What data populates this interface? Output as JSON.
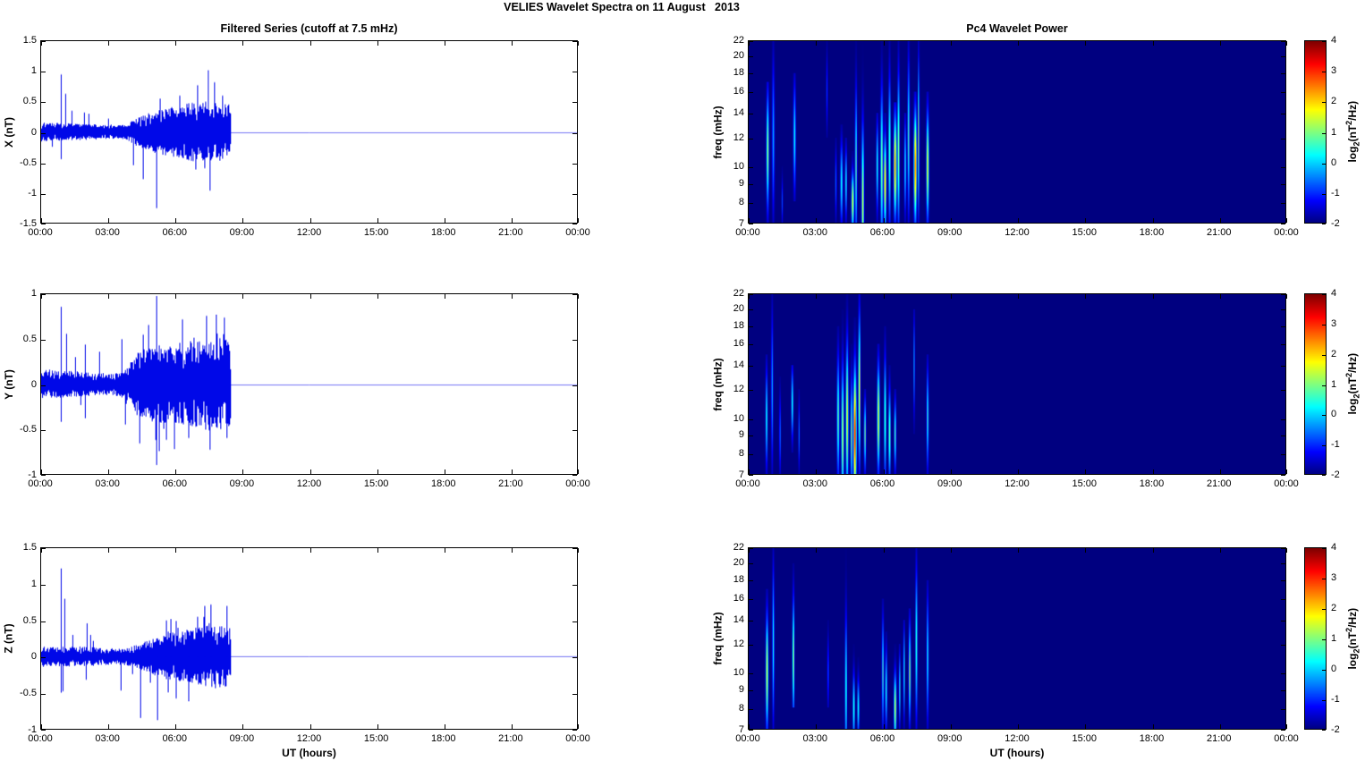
{
  "figure": {
    "title": "VELIES Wavelet Spectra on 11 August   2013"
  },
  "colorbar": {
    "ticks": [
      4,
      3,
      2,
      1,
      0,
      -1,
      -2
    ],
    "tick_labels": [
      "4",
      "3",
      "2",
      "1",
      "0",
      "-1",
      "-2"
    ],
    "vmin": -2,
    "vmax": 4,
    "label_parts": {
      "p1": "log",
      "sub": "2",
      "p2": "(nT",
      "sup": "2",
      "p3": "/Hz)"
    },
    "colormap": "jet",
    "background_hex": "#000080"
  },
  "chart_data": [
    {
      "type": "line",
      "component": "X",
      "title": "Filtered Series (cutoff at 7.5 mHz)",
      "ylabel": "X (nT)",
      "line_color": "#0008e8",
      "flat_line_color": "rgba(70,70,240,0.75)",
      "ylim": [
        -1.5,
        1.5
      ],
      "yticks": [
        -1.5,
        -1,
        -0.5,
        0,
        0.5,
        1,
        1.5
      ],
      "ytick_labels": [
        "-1.5",
        "-1",
        "-0.5",
        "0",
        "0.5",
        "1",
        "1.5"
      ],
      "xlim_hours": [
        0,
        24
      ],
      "xticks_hours": [
        0,
        3,
        6,
        9,
        12,
        15,
        18,
        21,
        24
      ],
      "xtick_labels": [
        "00:00",
        "03:00",
        "06:00",
        "09:00",
        "12:00",
        "15:00",
        "18:00",
        "21:00",
        "00:00"
      ],
      "signal": {
        "seed": 7,
        "end_hours": 8.5,
        "envelope": [
          [
            0,
            0.14
          ],
          [
            0.5,
            0.13
          ],
          [
            1,
            0.13
          ],
          [
            1.5,
            0.12
          ],
          [
            2,
            0.12
          ],
          [
            2.5,
            0.11
          ],
          [
            3,
            0.1
          ],
          [
            3.5,
            0.1
          ],
          [
            3.8,
            0.11
          ],
          [
            4.2,
            0.2
          ],
          [
            4.6,
            0.25
          ],
          [
            5,
            0.3
          ],
          [
            5.5,
            0.34
          ],
          [
            6,
            0.38
          ],
          [
            6.5,
            0.42
          ],
          [
            7,
            0.44
          ],
          [
            7.5,
            0.46
          ],
          [
            8,
            0.44
          ],
          [
            8.45,
            0.4
          ],
          [
            8.5,
            0.0
          ]
        ],
        "spikes": [
          [
            0.87,
            0.95
          ],
          [
            0.87,
            -0.45
          ],
          [
            1.07,
            0.63
          ],
          [
            1.35,
            0.35
          ],
          [
            1.9,
            0.32
          ],
          [
            2.1,
            0.3
          ],
          [
            3.0,
            0.22
          ],
          [
            4.1,
            -0.55
          ],
          [
            4.55,
            -0.78
          ],
          [
            5.15,
            -1.26
          ],
          [
            5.3,
            0.55
          ],
          [
            6.2,
            0.6
          ],
          [
            6.9,
            -0.62
          ],
          [
            7.3,
            -0.6
          ],
          [
            7.45,
            1.02
          ],
          [
            7.55,
            -0.97
          ],
          [
            7.75,
            0.82
          ],
          [
            8.1,
            0.6
          ]
        ]
      }
    },
    {
      "type": "heatmap",
      "component": "X",
      "title": "Pc4 Wavelet Power",
      "ylabel": "freq (mHz)",
      "ylim_mhz": [
        7,
        22
      ],
      "yscale": "log",
      "yticks": [
        7,
        8,
        9,
        10,
        12,
        14,
        16,
        18,
        20,
        22
      ],
      "xlim_hours": [
        0,
        24
      ],
      "xticks_hours": [
        0,
        3,
        6,
        9,
        12,
        15,
        18,
        21,
        24
      ],
      "xtick_labels": [
        "00:00",
        "03:00",
        "06:00",
        "09:00",
        "12:00",
        "15:00",
        "18:00",
        "21:00",
        "00:00"
      ],
      "clim": [
        -2,
        4
      ],
      "streak_fields": [
        "t_hours",
        "half_width_hours",
        "peak_log2_power",
        "f_low_mhz",
        "f_high_mhz",
        "f_peak_mhz"
      ],
      "streaks": [
        [
          0.85,
          0.05,
          1.3,
          7,
          17,
          11
        ],
        [
          1.1,
          0.05,
          -0.2,
          7,
          22,
          12
        ],
        [
          1.5,
          0.03,
          -0.8,
          7,
          10,
          8
        ],
        [
          2.05,
          0.05,
          0.3,
          8,
          18,
          12
        ],
        [
          3.5,
          0.03,
          -0.9,
          12,
          22,
          16
        ],
        [
          3.9,
          0.03,
          -0.5,
          7,
          12,
          9
        ],
        [
          4.15,
          0.05,
          0.4,
          7,
          13,
          9
        ],
        [
          4.35,
          0.04,
          0.3,
          7,
          12,
          9
        ],
        [
          4.65,
          0.05,
          1.8,
          7,
          11,
          8
        ],
        [
          4.8,
          0.04,
          0.8,
          7,
          22,
          10
        ],
        [
          5.1,
          0.05,
          1.6,
          7,
          22,
          8
        ],
        [
          5.75,
          0.04,
          0.5,
          7,
          14,
          10
        ],
        [
          5.95,
          0.05,
          1.2,
          7,
          22,
          10
        ],
        [
          6.1,
          0.05,
          2.2,
          7,
          14,
          9
        ],
        [
          6.3,
          0.04,
          1.0,
          7,
          22,
          11
        ],
        [
          6.55,
          0.06,
          2.6,
          7,
          15,
          10
        ],
        [
          6.7,
          0.04,
          1.5,
          7,
          22,
          11
        ],
        [
          7.0,
          0.04,
          0.4,
          7,
          14,
          10
        ],
        [
          7.15,
          0.04,
          0.8,
          7,
          22,
          12
        ],
        [
          7.45,
          0.06,
          2.8,
          7,
          16,
          10
        ],
        [
          7.6,
          0.03,
          1.2,
          7,
          22,
          12
        ],
        [
          8.0,
          0.05,
          1.9,
          7,
          16,
          10
        ]
      ]
    },
    {
      "type": "line",
      "component": "Y",
      "ylabel": "Y (nT)",
      "line_color": "#0008e8",
      "flat_line_color": "rgba(70,70,240,0.75)",
      "ylim": [
        -1,
        1
      ],
      "yticks": [
        -1,
        -0.5,
        0,
        0.5,
        1
      ],
      "ytick_labels": [
        "-1",
        "-0.5",
        "0",
        "0.5",
        "1"
      ],
      "xlim_hours": [
        0,
        24
      ],
      "xticks_hours": [
        0,
        3,
        6,
        9,
        12,
        15,
        18,
        21,
        24
      ],
      "xtick_labels": [
        "00:00",
        "03:00",
        "06:00",
        "09:00",
        "12:00",
        "15:00",
        "18:00",
        "21:00",
        "00:00"
      ],
      "signal": {
        "seed": 13,
        "end_hours": 8.5,
        "envelope": [
          [
            0,
            0.15
          ],
          [
            0.5,
            0.14
          ],
          [
            1,
            0.13
          ],
          [
            1.5,
            0.13
          ],
          [
            2,
            0.12
          ],
          [
            2.5,
            0.11
          ],
          [
            3,
            0.11
          ],
          [
            3.5,
            0.12
          ],
          [
            3.9,
            0.18
          ],
          [
            4.2,
            0.3
          ],
          [
            4.6,
            0.36
          ],
          [
            5,
            0.38
          ],
          [
            5.5,
            0.4
          ],
          [
            6,
            0.4
          ],
          [
            6.5,
            0.42
          ],
          [
            7,
            0.43
          ],
          [
            7.5,
            0.46
          ],
          [
            8,
            0.46
          ],
          [
            8.45,
            0.42
          ],
          [
            8.5,
            0.0
          ]
        ],
        "spikes": [
          [
            0.87,
            0.86
          ],
          [
            0.87,
            -0.42
          ],
          [
            1.1,
            0.56
          ],
          [
            1.5,
            0.3
          ],
          [
            1.95,
            0.44
          ],
          [
            1.95,
            -0.38
          ],
          [
            2.6,
            0.36
          ],
          [
            3.6,
            0.5
          ],
          [
            3.75,
            -0.45
          ],
          [
            4.4,
            -0.66
          ],
          [
            4.55,
            0.55
          ],
          [
            5.15,
            0.98
          ],
          [
            5.15,
            -0.9
          ],
          [
            5.6,
            -0.62
          ],
          [
            6.3,
            0.72
          ],
          [
            6.6,
            -0.6
          ],
          [
            7.4,
            0.76
          ],
          [
            7.55,
            -0.73
          ],
          [
            8.2,
            0.74
          ],
          [
            8.3,
            -0.6
          ]
        ]
      }
    },
    {
      "type": "heatmap",
      "component": "Y",
      "ylabel": "freq (mHz)",
      "ylim_mhz": [
        7,
        22
      ],
      "yscale": "log",
      "yticks": [
        7,
        8,
        9,
        10,
        12,
        14,
        16,
        18,
        20,
        22
      ],
      "xlim_hours": [
        0,
        24
      ],
      "xticks_hours": [
        0,
        3,
        6,
        9,
        12,
        15,
        18,
        21,
        24
      ],
      "xtick_labels": [
        "00:00",
        "03:00",
        "06:00",
        "09:00",
        "12:00",
        "15:00",
        "18:00",
        "21:00",
        "00:00"
      ],
      "clim": [
        -2,
        4
      ],
      "streak_fields": [
        "t_hours",
        "half_width_hours",
        "peak_log2_power",
        "f_low_mhz",
        "f_high_mhz",
        "f_peak_mhz"
      ],
      "streaks": [
        [
          0.8,
          0.04,
          0.5,
          7,
          15,
          10
        ],
        [
          1.05,
          0.04,
          -0.2,
          7,
          22,
          12
        ],
        [
          1.4,
          0.03,
          -0.4,
          7,
          13,
          9
        ],
        [
          1.95,
          0.04,
          0.5,
          8,
          14,
          11
        ],
        [
          2.25,
          0.03,
          -0.6,
          7,
          12,
          9
        ],
        [
          4.0,
          0.05,
          0.8,
          7,
          18,
          10
        ],
        [
          4.2,
          0.05,
          1.5,
          7,
          20,
          9
        ],
        [
          4.4,
          0.05,
          1.8,
          7,
          22,
          10
        ],
        [
          4.6,
          0.04,
          1.2,
          7,
          16,
          9
        ],
        [
          4.75,
          0.06,
          3.4,
          7,
          19,
          9
        ],
        [
          4.95,
          0.04,
          2.0,
          7,
          22,
          12
        ],
        [
          5.2,
          0.04,
          1.0,
          7,
          12,
          9
        ],
        [
          5.8,
          0.05,
          1.9,
          7,
          16,
          10
        ],
        [
          6.1,
          0.04,
          1.0,
          7,
          18,
          10
        ],
        [
          6.3,
          0.04,
          1.2,
          7,
          14,
          9
        ],
        [
          6.55,
          0.04,
          0.8,
          7,
          12,
          9
        ],
        [
          7.4,
          0.03,
          -0.3,
          9,
          20,
          14
        ],
        [
          8.0,
          0.04,
          0.6,
          7,
          15,
          10
        ]
      ]
    },
    {
      "type": "line",
      "component": "Z",
      "ylabel": "Z (nT)",
      "xlabel": "UT (hours)",
      "line_color": "#0008e8",
      "flat_line_color": "rgba(70,70,240,0.75)",
      "ylim": [
        -1,
        1.5
      ],
      "yticks": [
        -1,
        -0.5,
        0,
        0.5,
        1,
        1.5
      ],
      "ytick_labels": [
        "-1",
        "-0.5",
        "0",
        "0.5",
        "1",
        "1.5"
      ],
      "xlim_hours": [
        0,
        24
      ],
      "xticks_hours": [
        0,
        3,
        6,
        9,
        12,
        15,
        18,
        21,
        24
      ],
      "xtick_labels": [
        "00:00",
        "03:00",
        "06:00",
        "09:00",
        "12:00",
        "15:00",
        "18:00",
        "21:00",
        "00:00"
      ],
      "signal": {
        "seed": 29,
        "end_hours": 8.5,
        "envelope": [
          [
            0,
            0.13
          ],
          [
            0.5,
            0.12
          ],
          [
            1,
            0.12
          ],
          [
            1.5,
            0.12
          ],
          [
            2,
            0.12
          ],
          [
            2.5,
            0.11
          ],
          [
            3,
            0.1
          ],
          [
            3.5,
            0.1
          ],
          [
            4,
            0.12
          ],
          [
            4.5,
            0.17
          ],
          [
            5,
            0.22
          ],
          [
            5.5,
            0.28
          ],
          [
            6,
            0.3
          ],
          [
            6.5,
            0.33
          ],
          [
            7,
            0.36
          ],
          [
            7.5,
            0.4
          ],
          [
            8,
            0.38
          ],
          [
            8.45,
            0.36
          ],
          [
            8.5,
            0.0
          ]
        ],
        "spikes": [
          [
            0.87,
            1.22
          ],
          [
            0.87,
            -0.5
          ],
          [
            0.95,
            -0.48
          ],
          [
            1.05,
            0.8
          ],
          [
            1.4,
            0.3
          ],
          [
            2.0,
            -0.32
          ],
          [
            2.05,
            0.46
          ],
          [
            2.2,
            0.3
          ],
          [
            3.55,
            -0.47
          ],
          [
            4.45,
            -0.85
          ],
          [
            5.2,
            -0.88
          ],
          [
            5.6,
            0.5
          ],
          [
            5.8,
            0.52
          ],
          [
            6.6,
            -0.62
          ],
          [
            7.0,
            0.55
          ],
          [
            7.3,
            0.7
          ],
          [
            7.6,
            0.72
          ],
          [
            8.3,
            0.7
          ]
        ]
      }
    },
    {
      "type": "heatmap",
      "component": "Z",
      "ylabel": "freq (mHz)",
      "xlabel": "UT (hours)",
      "ylim_mhz": [
        7,
        22
      ],
      "yscale": "log",
      "yticks": [
        7,
        8,
        9,
        10,
        12,
        14,
        16,
        18,
        20,
        22
      ],
      "xlim_hours": [
        0,
        24
      ],
      "xticks_hours": [
        0,
        3,
        6,
        9,
        12,
        15,
        18,
        21,
        24
      ],
      "xtick_labels": [
        "00:00",
        "03:00",
        "06:00",
        "09:00",
        "12:00",
        "15:00",
        "18:00",
        "21:00",
        "00:00"
      ],
      "clim": [
        -2,
        4
      ],
      "streak_fields": [
        "t_hours",
        "half_width_hours",
        "peak_log2_power",
        "f_low_mhz",
        "f_high_mhz",
        "f_peak_mhz"
      ],
      "streaks": [
        [
          0.82,
          0.05,
          1.7,
          7,
          17,
          10
        ],
        [
          1.1,
          0.04,
          0.4,
          7,
          22,
          12
        ],
        [
          2.0,
          0.04,
          1.4,
          8,
          20,
          11
        ],
        [
          3.55,
          0.03,
          -0.6,
          8,
          14,
          10
        ],
        [
          4.35,
          0.04,
          0.6,
          7,
          22,
          9
        ],
        [
          4.7,
          0.04,
          0.7,
          7,
          12,
          8
        ],
        [
          4.9,
          0.04,
          0.5,
          7,
          11,
          8
        ],
        [
          6.0,
          0.04,
          0.7,
          7,
          16,
          10
        ],
        [
          6.15,
          0.04,
          0.5,
          7,
          13,
          9
        ],
        [
          6.55,
          0.05,
          1.6,
          7,
          12,
          8
        ],
        [
          6.75,
          0.03,
          0.6,
          7,
          12,
          9
        ],
        [
          6.95,
          0.03,
          0.5,
          7,
          14,
          10
        ],
        [
          7.2,
          0.04,
          1.3,
          7,
          15,
          10
        ],
        [
          7.5,
          0.04,
          0.8,
          7,
          22,
          12
        ],
        [
          8.0,
          0.04,
          0.4,
          7,
          18,
          11
        ]
      ]
    }
  ]
}
